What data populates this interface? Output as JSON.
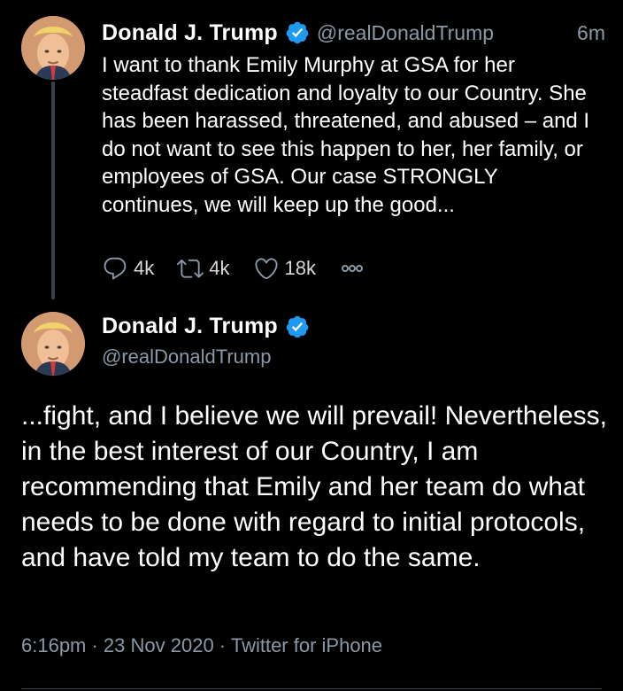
{
  "tweet1": {
    "author_name": "Donald J. Trump",
    "handle": "@realDonaldTrump",
    "time_ago": "6m",
    "text": "I want to thank Emily Murphy at GSA for her steadfast dedication and loyalty to our Country. She has been harassed, threatened, and abused – and I do not want to see this happen to her, her family, or employees of GSA. Our case STRONGLY continues, we will keep up the good...",
    "reply_count": "4k",
    "retweet_count": "4k",
    "like_count": "18k",
    "icons": [
      "avatar",
      "verified-badge-icon",
      "reply-icon",
      "retweet-icon",
      "like-icon",
      "more-icon"
    ]
  },
  "tweet2": {
    "author_name": "Donald J. Trump",
    "handle": "@realDonaldTrump",
    "text": "...fight, and I believe we will prevail! Nevertheless, in the best interest of our Country, I am recommending that Emily and her team do what needs to be done with regard to initial protocols, and have told my team to do the same.",
    "timestamp": "6:16pm · 23 Nov 2020 · Twitter for iPhone",
    "icons": [
      "avatar",
      "verified-badge-icon"
    ]
  },
  "colors": {
    "background": "#000000",
    "text_primary": "#ffffff",
    "text_secondary": "#8b98a5",
    "verified_blue": "#1d9bf0",
    "divider": "#38444d"
  }
}
